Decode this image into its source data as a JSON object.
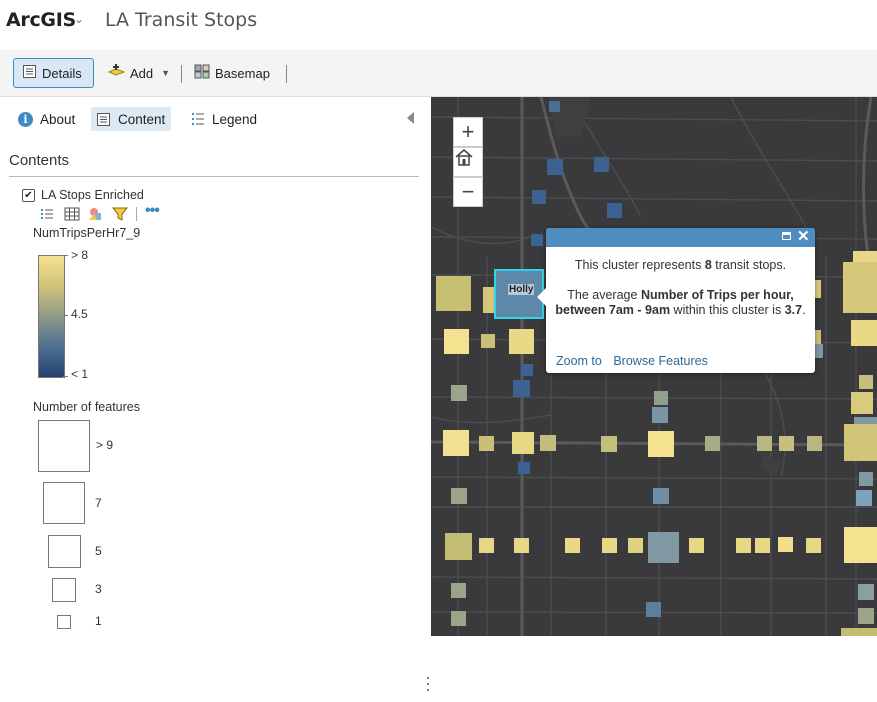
{
  "app": {
    "logo": "ArcGIS",
    "title": "LA Transit Stops"
  },
  "toolbar": {
    "details_label": "Details",
    "add_label": "Add",
    "basemap_label": "Basemap"
  },
  "tabs": {
    "about": "About",
    "content": "Content",
    "legend": "Legend"
  },
  "contents": {
    "heading": "Contents",
    "layer_name": "LA Stops Enriched",
    "layer_checked": true,
    "field_name": "NumTripsPerHr7_9",
    "ramp_labels": {
      "high": "> 8",
      "mid": "4.5",
      "low": "< 1"
    },
    "count_heading": "Number of features",
    "size_labels": [
      "> 9",
      "7",
      "5",
      "3",
      "1"
    ]
  },
  "colors": {
    "accent": "#3e8bc1",
    "popup_header": "#4f8cc0",
    "selection": "#2fd7e6",
    "map_bg": "#3a3a3c"
  },
  "map": {
    "zoom_in_label": "+",
    "zoom_out_label": "−",
    "selected_cluster_label": "Holly",
    "popup": {
      "line1_pre": "This cluster represents ",
      "line1_count": "8",
      "line1_post": " transit stops.",
      "line2_pre": "The average ",
      "line2_field": "Number of Trips per hour, between 7am - 9am",
      "line2_mid": " within this cluster is ",
      "line2_value": "3.7",
      "line2_post": ".",
      "link_zoom": "Zoom to",
      "link_browse": "Browse Features"
    }
  }
}
